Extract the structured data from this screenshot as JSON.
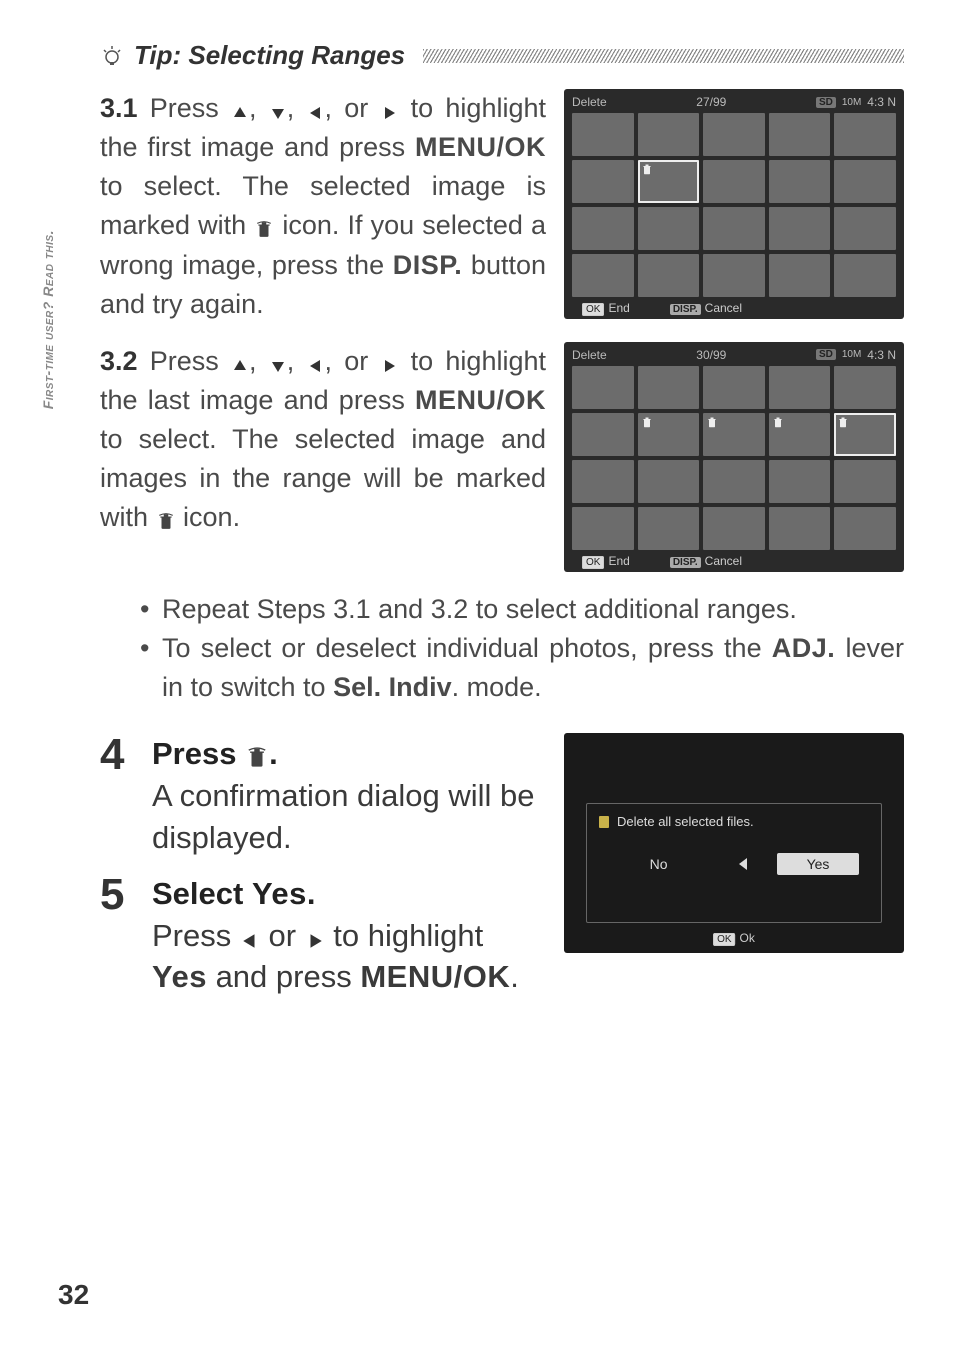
{
  "side_tab": "First-time user? Read this.",
  "tip": {
    "title": "Tip: Selecting Ranges"
  },
  "step31": {
    "num": "3.1",
    "pre": "Press ",
    "mid": " to highlight the first image and press ",
    "menuok": "MENU/OK",
    "post1": " to select. The selected image is marked with ",
    "post2": " icon. If you selected a wrong image, press the ",
    "disp": "DISP.",
    "post3": " button and try again."
  },
  "step32": {
    "num": "3.2",
    "pre": "Press ",
    "mid": " to highlight the last image and press ",
    "menuok": "MENU/OK",
    "post1": " to select. The selected image and images in the range will be marked with ",
    "post2": " icon."
  },
  "bullet1": "Repeat Steps 3.1 and 3.2 to select additional ranges.",
  "bullet2_a": "To select or deselect individual photos, press the ",
  "bullet2_adj": "ADJ.",
  "bullet2_b": " lever in to switch to ",
  "bullet2_mode": "Sel. Indiv",
  "bullet2_c": ". mode.",
  "step4": {
    "num": "4",
    "title_a": "Press ",
    "title_b": ".",
    "body": "A confirmation dialog will be displayed."
  },
  "step5": {
    "num": "5",
    "title_a": "Select ",
    "title_yes": "Yes",
    "title_b": ".",
    "body_a": "Press ",
    "body_b": " or ",
    "body_c": " to highlight ",
    "body_yes": "Yes",
    "body_d": " and press ",
    "menuok": "MENU/OK",
    "body_e": "."
  },
  "ss1": {
    "title": "Delete",
    "counter": "27/99",
    "tenm": "10M",
    "ratio": "4:3 N",
    "ok": "OK",
    "end": "End",
    "disp": "DISP.",
    "cancel": "Cancel"
  },
  "ss2": {
    "title": "Delete",
    "counter": "30/99",
    "tenm": "10M",
    "ratio": "4:3 N",
    "ok": "OK",
    "end": "End",
    "disp": "DISP.",
    "cancel": "Cancel"
  },
  "confirm": {
    "msg": "Delete all selected files.",
    "no": "No",
    "yes": "Yes",
    "ok": "OK",
    "okLabel": "Ok"
  },
  "page_number": "32"
}
